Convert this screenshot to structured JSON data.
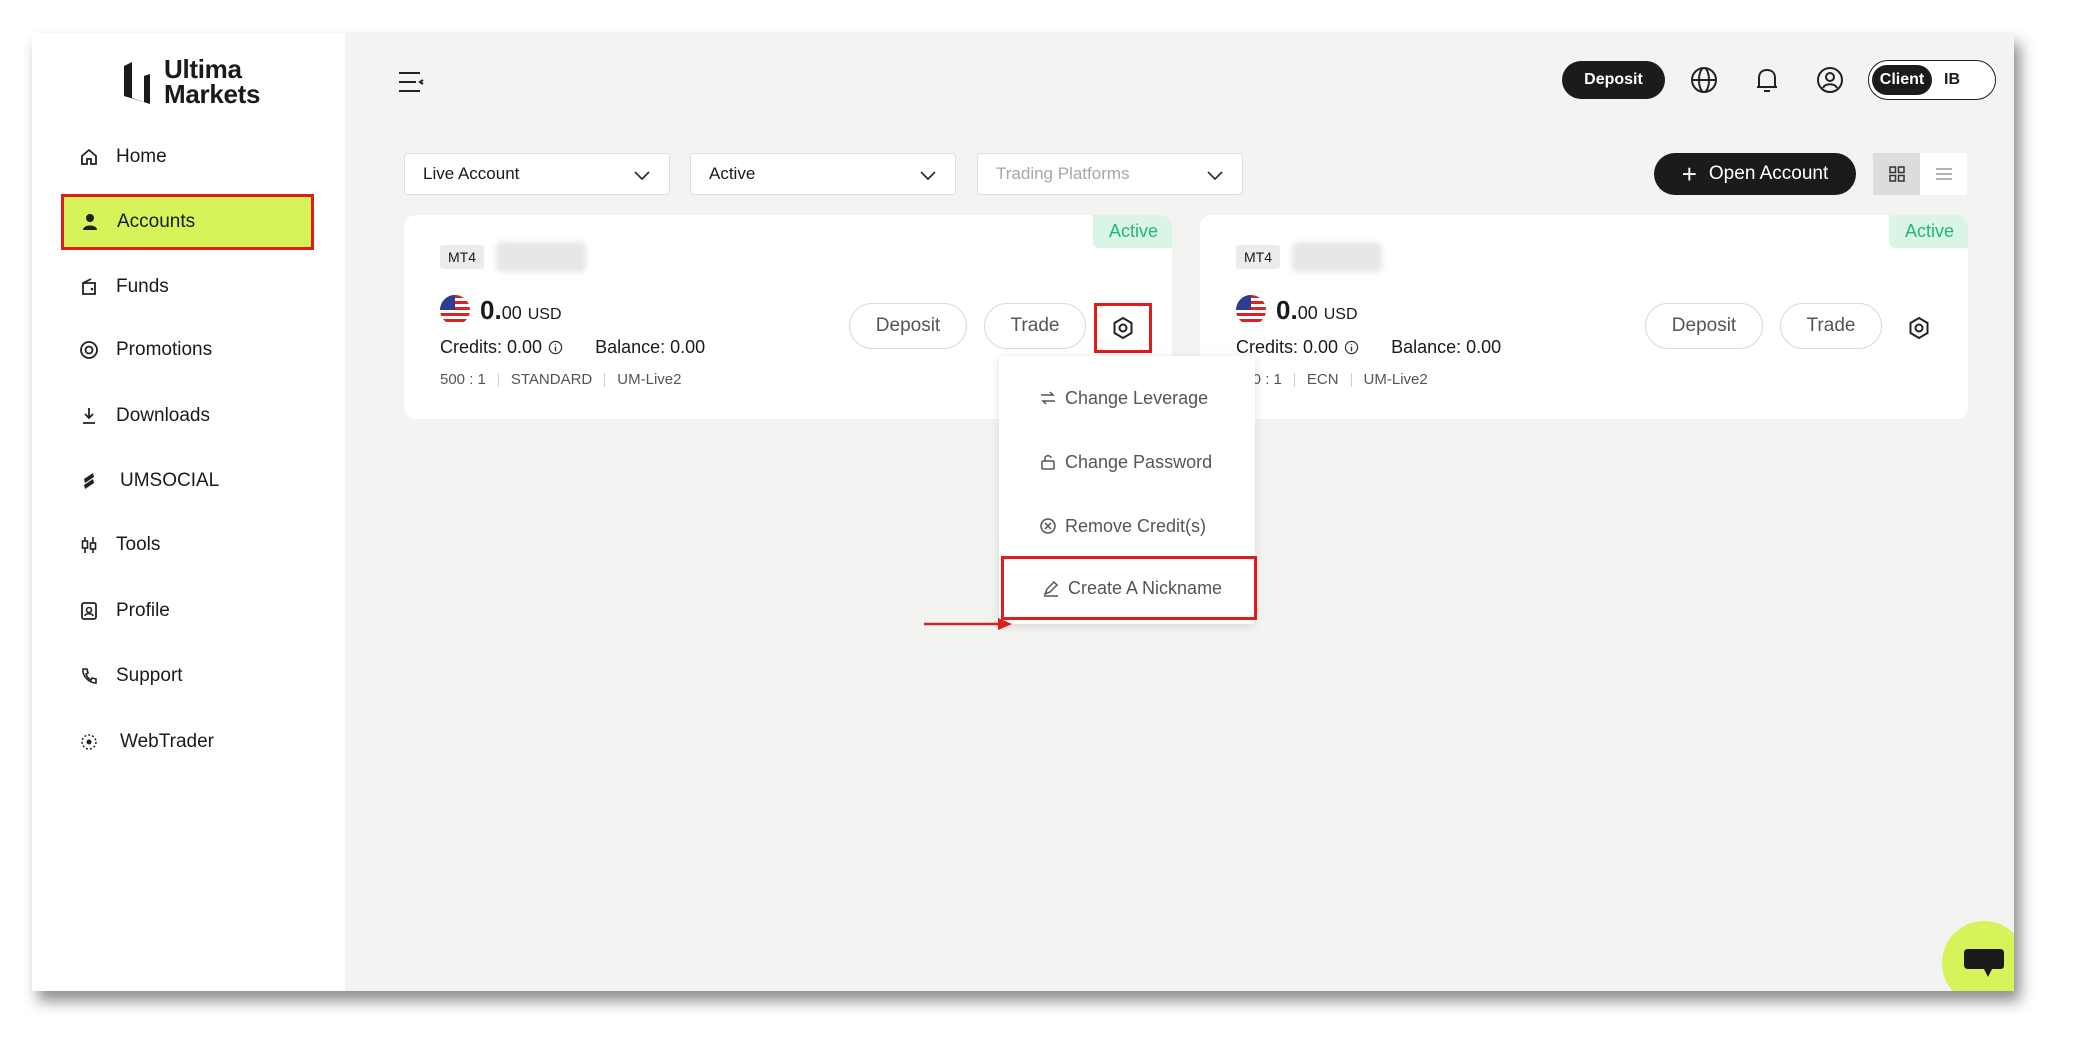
{
  "brand": {
    "line1": "Ultima",
    "line2": "Markets"
  },
  "sidebar": {
    "items": [
      {
        "label": "Home",
        "icon": "home-icon"
      },
      {
        "label": "Accounts",
        "icon": "user-icon"
      },
      {
        "label": "Funds",
        "icon": "wallet-icon"
      },
      {
        "label": "Promotions",
        "icon": "target-icon"
      },
      {
        "label": "Downloads",
        "icon": "download-icon"
      },
      {
        "label": "UMSOCIAL",
        "icon": "umsocial-icon"
      },
      {
        "label": "Tools",
        "icon": "candlestick-icon"
      },
      {
        "label": "Profile",
        "icon": "profile-card-icon"
      },
      {
        "label": "Support",
        "icon": "phone-icon"
      },
      {
        "label": "WebTrader",
        "icon": "webtrader-icon"
      }
    ]
  },
  "topbar": {
    "deposit_label": "Deposit",
    "role_client": "Client",
    "role_ib": "IB"
  },
  "filters": {
    "account_type": "Live Account",
    "status": "Active",
    "platform_placeholder": "Trading Platforms"
  },
  "open_account_label": "Open Account",
  "accounts": [
    {
      "status": "Active",
      "platform": "MT4",
      "amount_int": "0.",
      "amount_dec": "00",
      "currency": "USD",
      "credits_label": "Credits: 0.00",
      "balance_label": "Balance: 0.00",
      "leverage": "500 : 1",
      "type": "STANDARD",
      "server": "UM-Live2",
      "deposit_label": "Deposit",
      "trade_label": "Trade"
    },
    {
      "status": "Active",
      "platform": "MT4",
      "amount_int": "0.",
      "amount_dec": "00",
      "currency": "USD",
      "credits_label": "Credits: 0.00",
      "balance_label": "Balance: 0.00",
      "leverage": "500 : 1",
      "type": "ECN",
      "server": "UM-Live2",
      "deposit_label": "Deposit",
      "trade_label": "Trade"
    }
  ],
  "dropdown": {
    "items": [
      "Change Leverage",
      "Change Password",
      "Remove Credit(s)",
      "Create A Nickname"
    ]
  },
  "colors": {
    "accent": "#d6f35a",
    "highlight": "#e01b1b",
    "active_green": "#1fb77a",
    "dark": "#1b1b1b"
  }
}
